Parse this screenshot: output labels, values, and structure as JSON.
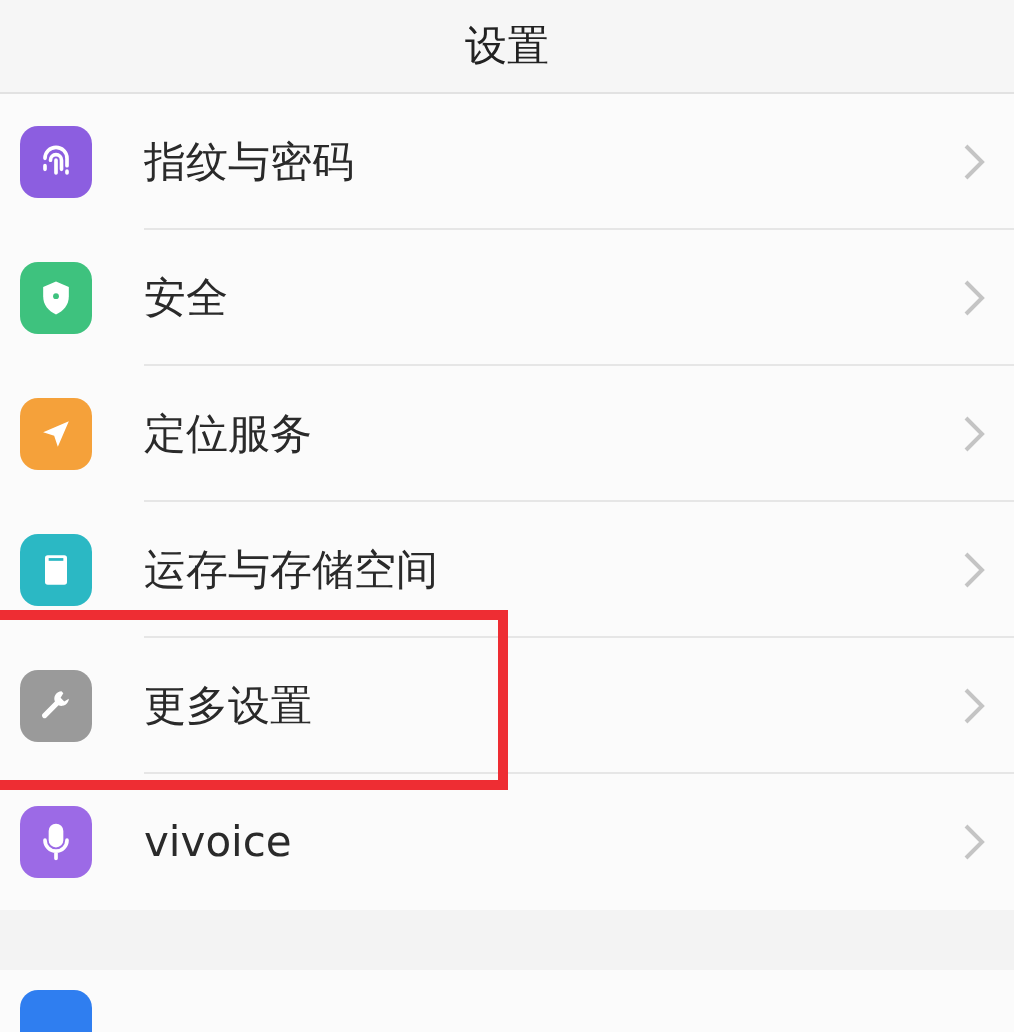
{
  "header": {
    "title": "设置"
  },
  "items": [
    {
      "kind": "fingerprint",
      "label": "指纹与密码",
      "color": "#8c5ee0",
      "highlighted": false
    },
    {
      "kind": "shield",
      "label": "安全",
      "color": "#3ec27e",
      "highlighted": false
    },
    {
      "kind": "location",
      "label": "定位服务",
      "color": "#f5a13a",
      "highlighted": false
    },
    {
      "kind": "storage",
      "label": "运存与存储空间",
      "color": "#2bb8c4",
      "highlighted": false
    },
    {
      "kind": "wrench",
      "label": "更多设置",
      "color": "#9a9a9a",
      "highlighted": true
    },
    {
      "kind": "mic",
      "label": "vivoice",
      "color": "#9c6ae6",
      "highlighted": false
    }
  ],
  "next_section": {
    "kind": "cut",
    "color": "#2f7ef0"
  }
}
